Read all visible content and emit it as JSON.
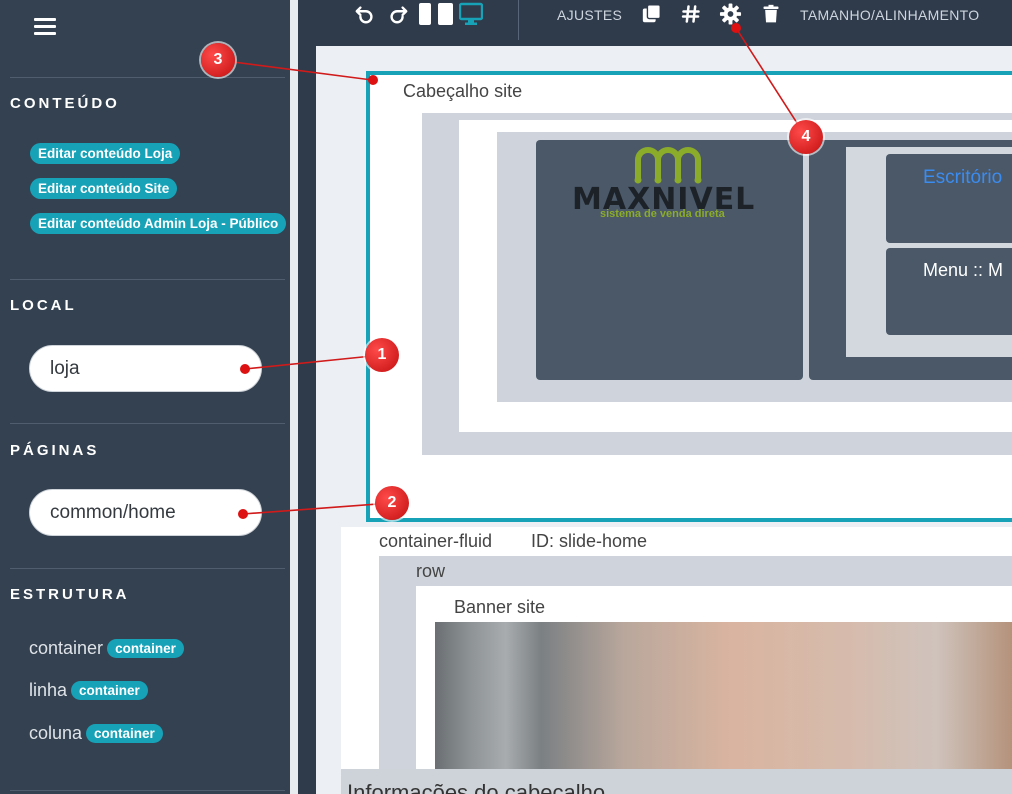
{
  "sidebar": {
    "sections": {
      "conteudo": "CONTEÚDO",
      "local": "LOCAL",
      "paginas": "PÁGINAS",
      "estrutura": "ESTRUTURA"
    },
    "content_links": [
      "Editar conteúdo Loja",
      "Editar conteúdo Site",
      "Editar conteúdo Admin Loja - Público"
    ],
    "local_value": "loja",
    "paginas_value": "common/home",
    "structure": [
      {
        "label": "container",
        "badge": "container"
      },
      {
        "label": "linha",
        "badge": "container"
      },
      {
        "label": "coluna",
        "badge": "container"
      }
    ]
  },
  "toolbar": {
    "ajustes": "AJUSTES",
    "tamanho": "TAMANHO/ALINHAMENTO"
  },
  "canvas": {
    "cabecalho_label": "Cabeçalho site",
    "logo_main": "MAXNIVEL",
    "logo_sub": "sistema de venda direta",
    "escritorio": "Escritório",
    "menu": "Menu :: M",
    "container_fluid": "container-fluid",
    "slide_id": "ID: slide-home",
    "row_label": "row",
    "banner_label": "Banner site",
    "bottom_label": "Informações do cabeçalho"
  },
  "callouts": [
    "1",
    "2",
    "3",
    "4"
  ],
  "colors": {
    "accent": "#17a2b8",
    "sidebar_bg": "#344150",
    "callout": "#d11a1a",
    "logo_green": "#8bab2b"
  }
}
